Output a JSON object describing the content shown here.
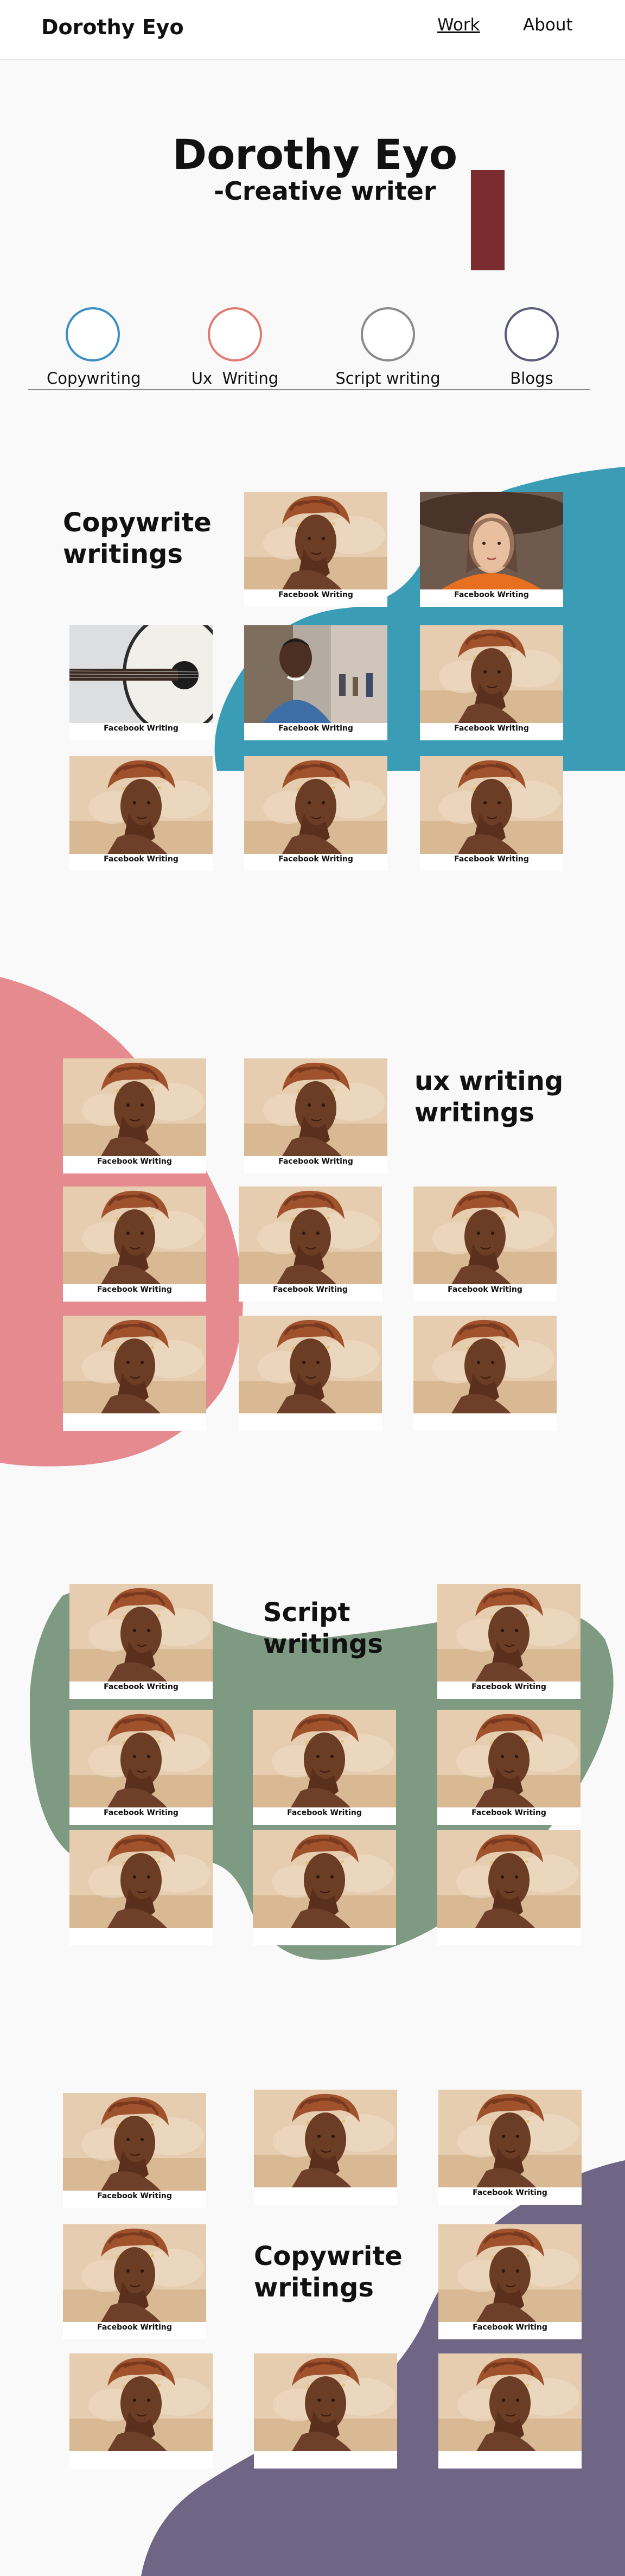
{
  "header": {
    "brand": "Dorothy Eyo",
    "nav": {
      "work": "Work",
      "about": "About"
    }
  },
  "hero": {
    "name": "Dorothy Eyo",
    "tagline": "-Creative writer",
    "accent_color": "#7b2c2f"
  },
  "categories": [
    {
      "label": "Copywriting",
      "ring_color": "#3a8fc7"
    },
    {
      "label": "Ux  Writing",
      "ring_color": "#e07a72"
    },
    {
      "label": "Script writing",
      "ring_color": "#8a8a8a"
    },
    {
      "label": "Blogs",
      "ring_color": "#5a5a7a"
    }
  ],
  "sections": {
    "copywrite": {
      "title": "Copywrite\nwritings",
      "blob_color": "#3a9db5"
    },
    "ux": {
      "title": "ux writing\nwritings",
      "blob_color": "#e58a8f"
    },
    "script": {
      "title": "Script\nwritings",
      "blob_color": "#7e9a82"
    },
    "copywrite2": {
      "title": "Copywrite\nwritings",
      "blob_color": "#6f6585"
    }
  },
  "card_caption": "Facebook Writing",
  "cards": {
    "s1": [
      {
        "image": "woman-portrait-photo",
        "caption": "Facebook Writing"
      },
      {
        "image": "woman-hat-photo",
        "caption": "Facebook Writing"
      },
      {
        "image": "guitar-photo",
        "caption": "Facebook Writing"
      },
      {
        "image": "man-street-photo",
        "caption": "Facebook Writing"
      },
      {
        "image": "woman-portrait-photo",
        "caption": "Facebook Writing"
      },
      {
        "image": "woman-portrait-photo",
        "caption": "Facebook Writing"
      },
      {
        "image": "woman-portrait-photo",
        "caption": "Facebook Writing"
      },
      {
        "image": "woman-portrait-photo",
        "caption": "Facebook Writing"
      }
    ],
    "s2": [
      {
        "image": "woman-portrait-photo",
        "caption": "Facebook Writing"
      },
      {
        "image": "woman-portrait-photo",
        "caption": "Facebook Writing"
      },
      {
        "image": "woman-portrait-photo",
        "caption": "Facebook Writing"
      },
      {
        "image": "woman-portrait-photo",
        "caption": "Facebook Writing"
      },
      {
        "image": "woman-portrait-photo",
        "caption": "Facebook Writing"
      },
      {
        "image": "woman-portrait-photo",
        "caption": ""
      },
      {
        "image": "woman-portrait-photo",
        "caption": ""
      },
      {
        "image": "woman-portrait-photo",
        "caption": ""
      }
    ],
    "s3": [
      {
        "image": "woman-portrait-photo",
        "caption": "Facebook Writing"
      },
      {
        "image": "woman-portrait-photo",
        "caption": "Facebook Writing"
      },
      {
        "image": "woman-portrait-photo",
        "caption": "Facebook Writing"
      },
      {
        "image": "woman-portrait-photo",
        "caption": "Facebook Writing"
      },
      {
        "image": "woman-portrait-photo",
        "caption": "Facebook Writing"
      },
      {
        "image": "woman-portrait-photo",
        "caption": ""
      },
      {
        "image": "woman-portrait-photo",
        "caption": ""
      },
      {
        "image": "woman-portrait-photo",
        "caption": ""
      }
    ],
    "s4": [
      {
        "image": "woman-portrait-photo",
        "caption": "Facebook Writing"
      },
      {
        "image": "woman-portrait-photo",
        "caption": ""
      },
      {
        "image": "woman-portrait-photo",
        "caption": "Facebook Writing"
      },
      {
        "image": "woman-portrait-photo",
        "caption": "Facebook Writing"
      },
      {
        "image": "woman-portrait-photo",
        "caption": "Facebook Writing"
      },
      {
        "image": "woman-portrait-photo",
        "caption": ""
      },
      {
        "image": "woman-portrait-photo",
        "caption": ""
      },
      {
        "image": "woman-portrait-photo",
        "caption": ""
      }
    ]
  }
}
